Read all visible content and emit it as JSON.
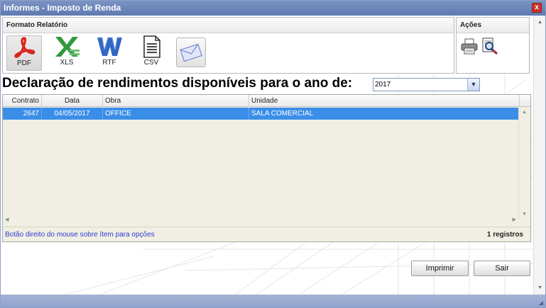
{
  "window": {
    "title": "Informes - Imposto de Renda",
    "close_label": "x"
  },
  "formats_panel": {
    "title": "Formato Relatório",
    "items": [
      {
        "label": "PDF",
        "icon": "pdf-icon",
        "selected": true
      },
      {
        "label": "XLS",
        "icon": "xls-icon",
        "selected": false
      },
      {
        "label": "RTF",
        "icon": "rtf-icon",
        "selected": false
      },
      {
        "label": "CSV",
        "icon": "csv-icon",
        "selected": false
      }
    ],
    "email_icon": "envelope-icon"
  },
  "acoes_panel": {
    "title": "Ações",
    "icons": [
      "printer-icon",
      "preview-icon"
    ]
  },
  "declaration": {
    "label": "Declaração de rendimentos disponíveis para o ano de:",
    "year": "2017"
  },
  "grid": {
    "columns": [
      "Contrato",
      "Data",
      "Obra",
      "Unidade"
    ],
    "rows": [
      {
        "contrato": "2647",
        "data": "04/05/2017",
        "obra": "OFFICE",
        "unidade": "SALA COMERCIAL"
      }
    ],
    "hint": "Botão direito do mouse sobre ítem para opções",
    "count": "1 registros"
  },
  "buttons": {
    "print": "Imprimir",
    "exit": "Sair"
  },
  "colors": {
    "titlebar": "#5f7ab0",
    "selection": "#3b8ee8",
    "grid_bg": "#f1efe3",
    "hint": "#2a3bd1",
    "pdf": "#d9241b",
    "xls": "#2f9a3e",
    "rtf": "#3466c4"
  }
}
